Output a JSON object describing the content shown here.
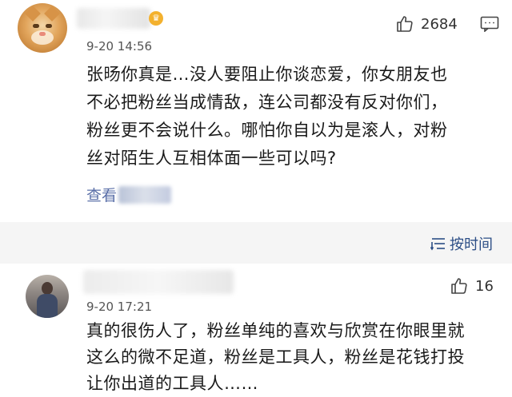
{
  "comments": [
    {
      "time": "9-20 14:56",
      "likes": "2684",
      "text_lines": [
        "张旸你真是…没人要阻止你谈恋爱，你女朋友也",
        "不必把粉丝当成情敌，连公司都没有反对你们，",
        "粉丝更不会说什么。哪怕你自以为是滚人，对粉",
        "丝对陌生人互相体面一些可以吗?"
      ],
      "view_more": "查看"
    },
    {
      "time": "9-20 17:21",
      "likes": "16",
      "text_lines": [
        "真的很伤人了，粉丝单纯的喜欢与欣赏在你眼里就",
        "这么的微不足道，粉丝是工具人，粉丝是花钱打投",
        "让你出道的工具人……"
      ]
    }
  ],
  "sort": {
    "label": "按时间"
  },
  "icons": {
    "like": "thumbs-up-icon",
    "reply": "comment-icon",
    "sort": "sort-icon",
    "vip": "vip-crown-icon"
  },
  "colors": {
    "link": "#5a6fa8",
    "sort": "#2c4e86",
    "divider_bg": "#f5f5f5"
  }
}
